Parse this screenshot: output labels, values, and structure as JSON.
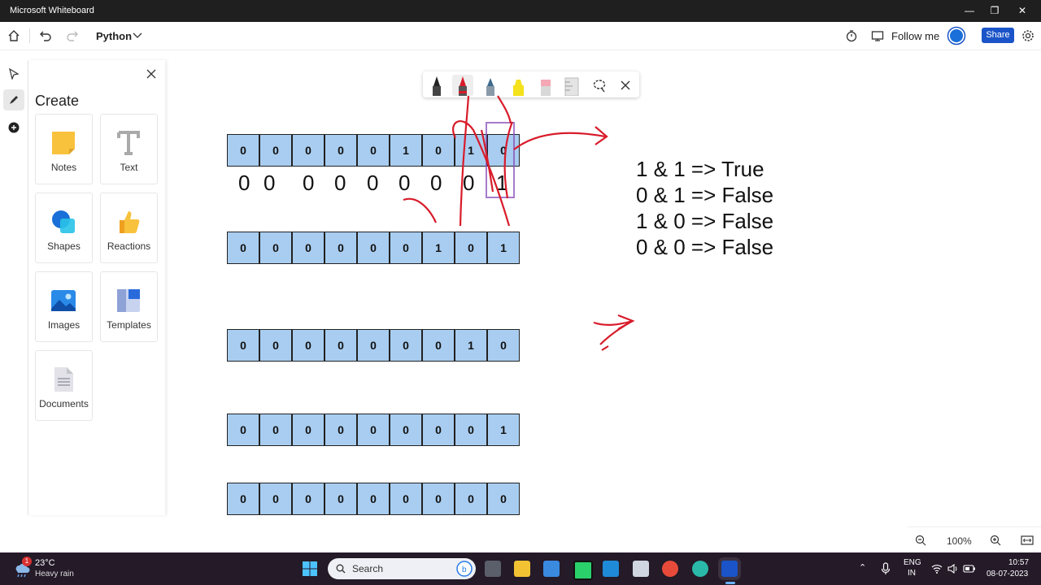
{
  "window": {
    "title": "Microsoft Whiteboard",
    "min": "—",
    "restore": "❐",
    "close": "✕"
  },
  "appbar": {
    "board_name": "Python",
    "follow_me": "Follow me",
    "share": "Share"
  },
  "create_panel": {
    "title": "Create",
    "tiles": [
      {
        "label": "Notes"
      },
      {
        "label": "Text"
      },
      {
        "label": "Shapes"
      },
      {
        "label": "Reactions"
      },
      {
        "label": "Images"
      },
      {
        "label": "Templates"
      },
      {
        "label": "Documents"
      }
    ]
  },
  "board": {
    "rows": [
      [
        "0",
        "0",
        "0",
        "0",
        "0",
        "1",
        "0",
        "1",
        "0"
      ],
      [
        "0",
        "0",
        "0",
        "0",
        "0",
        "0",
        "1",
        "0",
        "1"
      ],
      [
        "0",
        "0",
        "0",
        "0",
        "0",
        "0",
        "0",
        "1",
        "0"
      ],
      [
        "0",
        "0",
        "0",
        "0",
        "0",
        "0",
        "0",
        "0",
        "1"
      ],
      [
        "0",
        "0",
        "0",
        "0",
        "0",
        "0",
        "0",
        "0",
        "0"
      ]
    ],
    "handwritten": [
      "0",
      "0",
      "0",
      "0",
      "0",
      "0",
      "0",
      "0",
      "1"
    ],
    "explanation": [
      "1 & 1 => True",
      "0 & 1 => False",
      "1 & 0 => False",
      "0 & 0 => False"
    ]
  },
  "zoom": {
    "level": "100%"
  },
  "taskbar": {
    "weather_temp": "23°C",
    "weather_desc": "Heavy rain",
    "weather_badge": "1",
    "search": "Search",
    "lang_1": "ENG",
    "lang_2": "IN",
    "time": "10:57",
    "date": "08-07-2023"
  }
}
